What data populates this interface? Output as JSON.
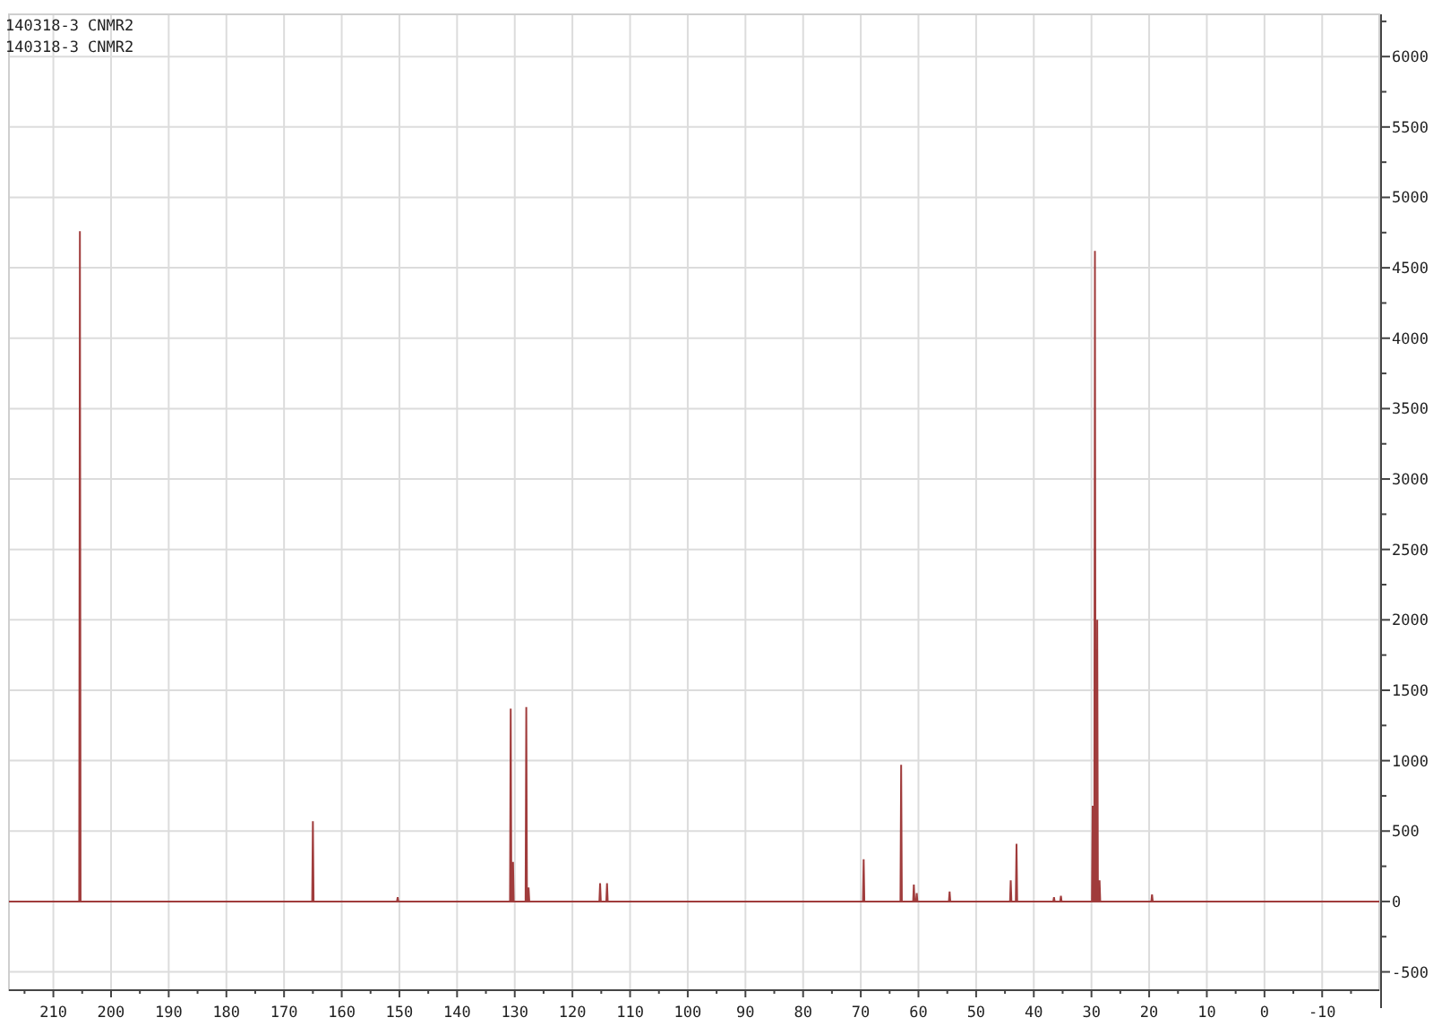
{
  "spectrum": {
    "label": "140318-3 CNMR2",
    "chart_data": {
      "type": "line",
      "grid": true,
      "xlim": [
        217.7,
        -19.9
      ],
      "ylim": [
        -630,
        6300
      ],
      "xticks": [
        210,
        200,
        190,
        180,
        170,
        160,
        150,
        140,
        130,
        120,
        110,
        100,
        90,
        80,
        70,
        60,
        50,
        40,
        30,
        20,
        10,
        0,
        -10
      ],
      "yticks": [
        6000,
        5500,
        5000,
        4500,
        4000,
        3500,
        3000,
        2500,
        2000,
        1500,
        1000,
        500,
        0,
        -500
      ],
      "x": [
        217.7,
        205.52,
        205.4,
        205.28,
        165.12,
        165.0,
        164.88,
        150.42,
        150.3,
        150.18,
        130.82,
        130.7,
        130.58,
        130.42,
        130.3,
        130.18,
        128.12,
        128.0,
        127.88,
        127.72,
        127.6,
        127.48,
        115.32,
        115.2,
        115.08,
        114.12,
        114.0,
        113.88,
        69.62,
        69.5,
        69.38,
        63.12,
        63.0,
        62.88,
        60.92,
        60.8,
        60.68,
        60.42,
        60.3,
        60.18,
        54.72,
        54.6,
        54.48,
        44.12,
        44.0,
        43.88,
        43.12,
        43.0,
        42.88,
        36.62,
        36.5,
        36.38,
        35.42,
        35.3,
        35.18,
        29.92,
        29.8,
        29.68,
        29.52,
        29.4,
        29.28,
        29.12,
        29.0,
        28.88,
        28.72,
        28.6,
        28.48,
        19.62,
        19.5,
        19.38,
        -19.9
      ],
      "series": [
        {
          "name": "140318-3 CNMR2",
          "color": "#a03c3c",
          "values": [
            0,
            0,
            4760,
            0,
            0,
            570,
            0,
            0,
            30,
            0,
            0,
            1370,
            0,
            0,
            280,
            0,
            0,
            1380,
            0,
            0,
            100,
            0,
            0,
            130,
            0,
            0,
            130,
            0,
            0,
            300,
            0,
            0,
            970,
            0,
            0,
            120,
            0,
            0,
            60,
            0,
            0,
            70,
            0,
            0,
            150,
            0,
            0,
            410,
            0,
            0,
            30,
            0,
            0,
            40,
            0,
            0,
            680,
            0,
            0,
            4620,
            0,
            0,
            2000,
            0,
            0,
            150,
            0,
            0,
            50,
            0,
            0
          ]
        }
      ]
    }
  }
}
